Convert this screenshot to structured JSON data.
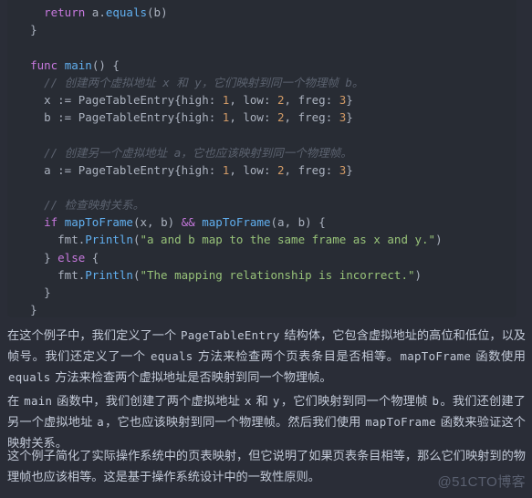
{
  "code_block": {
    "language": "go",
    "background_color": "#282c34",
    "lines": [
      {
        "indent": 2,
        "tokens": [
          {
            "t": "return",
            "c": "kw"
          },
          {
            "t": " ",
            "c": "punc"
          },
          {
            "t": "a",
            "c": "var"
          },
          {
            "t": ".",
            "c": "punc"
          },
          {
            "t": "equals",
            "c": "fn"
          },
          {
            "t": "(b)",
            "c": "punc"
          }
        ]
      },
      {
        "indent": 1,
        "tokens": [
          {
            "t": "}",
            "c": "punc"
          }
        ]
      },
      {
        "indent": 0,
        "tokens": []
      },
      {
        "indent": 1,
        "tokens": [
          {
            "t": "func",
            "c": "kw"
          },
          {
            "t": " ",
            "c": "punc"
          },
          {
            "t": "main",
            "c": "fn"
          },
          {
            "t": "() {",
            "c": "punc"
          }
        ]
      },
      {
        "indent": 2,
        "tokens": [
          {
            "t": "// 创建两个虚拟地址 x 和 y，它们映射到同一个物理帧 b。",
            "c": "cmt"
          }
        ]
      },
      {
        "indent": 2,
        "tokens": [
          {
            "t": "x := ",
            "c": "var"
          },
          {
            "t": "PageTableEntry",
            "c": "typ"
          },
          {
            "t": "{high: ",
            "c": "fld"
          },
          {
            "t": "1",
            "c": "num"
          },
          {
            "t": ", low: ",
            "c": "fld"
          },
          {
            "t": "2",
            "c": "num"
          },
          {
            "t": ", freg: ",
            "c": "fld"
          },
          {
            "t": "3",
            "c": "num"
          },
          {
            "t": "}",
            "c": "punc"
          }
        ]
      },
      {
        "indent": 2,
        "tokens": [
          {
            "t": "b := ",
            "c": "var"
          },
          {
            "t": "PageTableEntry",
            "c": "typ"
          },
          {
            "t": "{high: ",
            "c": "fld"
          },
          {
            "t": "1",
            "c": "num"
          },
          {
            "t": ", low: ",
            "c": "fld"
          },
          {
            "t": "2",
            "c": "num"
          },
          {
            "t": ", freg: ",
            "c": "fld"
          },
          {
            "t": "3",
            "c": "num"
          },
          {
            "t": "}",
            "c": "punc"
          }
        ]
      },
      {
        "indent": 0,
        "tokens": []
      },
      {
        "indent": 2,
        "tokens": [
          {
            "t": "// 创建另一个虚拟地址 a，它也应该映射到同一个物理帧。",
            "c": "cmt"
          }
        ]
      },
      {
        "indent": 2,
        "tokens": [
          {
            "t": "a := ",
            "c": "var"
          },
          {
            "t": "PageTableEntry",
            "c": "typ"
          },
          {
            "t": "{high: ",
            "c": "fld"
          },
          {
            "t": "1",
            "c": "num"
          },
          {
            "t": ", low: ",
            "c": "fld"
          },
          {
            "t": "2",
            "c": "num"
          },
          {
            "t": ", freg: ",
            "c": "fld"
          },
          {
            "t": "3",
            "c": "num"
          },
          {
            "t": "}",
            "c": "punc"
          }
        ]
      },
      {
        "indent": 0,
        "tokens": []
      },
      {
        "indent": 2,
        "tokens": [
          {
            "t": "// 检查映射关系。",
            "c": "cmt"
          }
        ]
      },
      {
        "indent": 2,
        "tokens": [
          {
            "t": "if",
            "c": "kw"
          },
          {
            "t": " ",
            "c": "punc"
          },
          {
            "t": "mapToFrame",
            "c": "fn"
          },
          {
            "t": "(x, b) ",
            "c": "punc"
          },
          {
            "t": "&&",
            "c": "kw"
          },
          {
            "t": " ",
            "c": "punc"
          },
          {
            "t": "mapToFrame",
            "c": "fn"
          },
          {
            "t": "(a, b) {",
            "c": "punc"
          }
        ]
      },
      {
        "indent": 3,
        "tokens": [
          {
            "t": "fmt",
            "c": "var"
          },
          {
            "t": ".",
            "c": "punc"
          },
          {
            "t": "Println",
            "c": "fn"
          },
          {
            "t": "(",
            "c": "punc"
          },
          {
            "t": "\"a and b map to the same frame as x and y.\"",
            "c": "str"
          },
          {
            "t": ")",
            "c": "punc"
          }
        ]
      },
      {
        "indent": 2,
        "tokens": [
          {
            "t": "} ",
            "c": "punc"
          },
          {
            "t": "else",
            "c": "kw"
          },
          {
            "t": " {",
            "c": "punc"
          }
        ]
      },
      {
        "indent": 3,
        "tokens": [
          {
            "t": "fmt",
            "c": "var"
          },
          {
            "t": ".",
            "c": "punc"
          },
          {
            "t": "Println",
            "c": "fn"
          },
          {
            "t": "(",
            "c": "punc"
          },
          {
            "t": "\"The mapping relationship is incorrect.\"",
            "c": "str"
          },
          {
            "t": ")",
            "c": "punc"
          }
        ]
      },
      {
        "indent": 2,
        "tokens": [
          {
            "t": "}",
            "c": "punc"
          }
        ]
      },
      {
        "indent": 1,
        "tokens": [
          {
            "t": "}",
            "c": "punc"
          }
        ]
      }
    ]
  },
  "prose": {
    "paragraph_1": [
      {
        "t": "在这个例子中，我们定义了一个 ",
        "code": false
      },
      {
        "t": "PageTableEntry",
        "code": true
      },
      {
        "t": " 结构体，它包含虚拟地址的高位和低位，以及帧号。我们还定义了一个 ",
        "code": false
      },
      {
        "t": "equals",
        "code": true
      },
      {
        "t": " 方法来检查两个页表条目是否相等。",
        "code": false
      },
      {
        "t": "mapToFrame",
        "code": true
      },
      {
        "t": " 函数使用 ",
        "code": false
      },
      {
        "t": "equals",
        "code": true
      },
      {
        "t": " 方法来检查两个虚拟地址是否映射到同一个物理帧。",
        "code": false
      }
    ],
    "paragraph_2": [
      {
        "t": "在 ",
        "code": false
      },
      {
        "t": "main",
        "code": true
      },
      {
        "t": " 函数中，我们创建了两个虚拟地址 ",
        "code": false
      },
      {
        "t": "x",
        "code": true
      },
      {
        "t": " 和 ",
        "code": false
      },
      {
        "t": "y",
        "code": true
      },
      {
        "t": "，它们映射到同一个物理帧 ",
        "code": false
      },
      {
        "t": "b",
        "code": true
      },
      {
        "t": "。我们还创建了另一个虚拟地址 ",
        "code": false
      },
      {
        "t": "a",
        "code": true
      },
      {
        "t": "，它也应该映射到同一个物理帧。然后我们使用 ",
        "code": false
      },
      {
        "t": "mapToFrame",
        "code": true
      },
      {
        "t": " 函数来验证这个映射关系。",
        "code": false
      }
    ],
    "paragraph_3": [
      {
        "t": "这个例子简化了实际操作系统中的页表映射，但它说明了如果页表条目相等，那么它们映射到的物理帧也应该相等。这是基于操作系统设计中的一致性原则。",
        "code": false
      }
    ]
  },
  "watermark": {
    "text": "@51CTO博客"
  }
}
